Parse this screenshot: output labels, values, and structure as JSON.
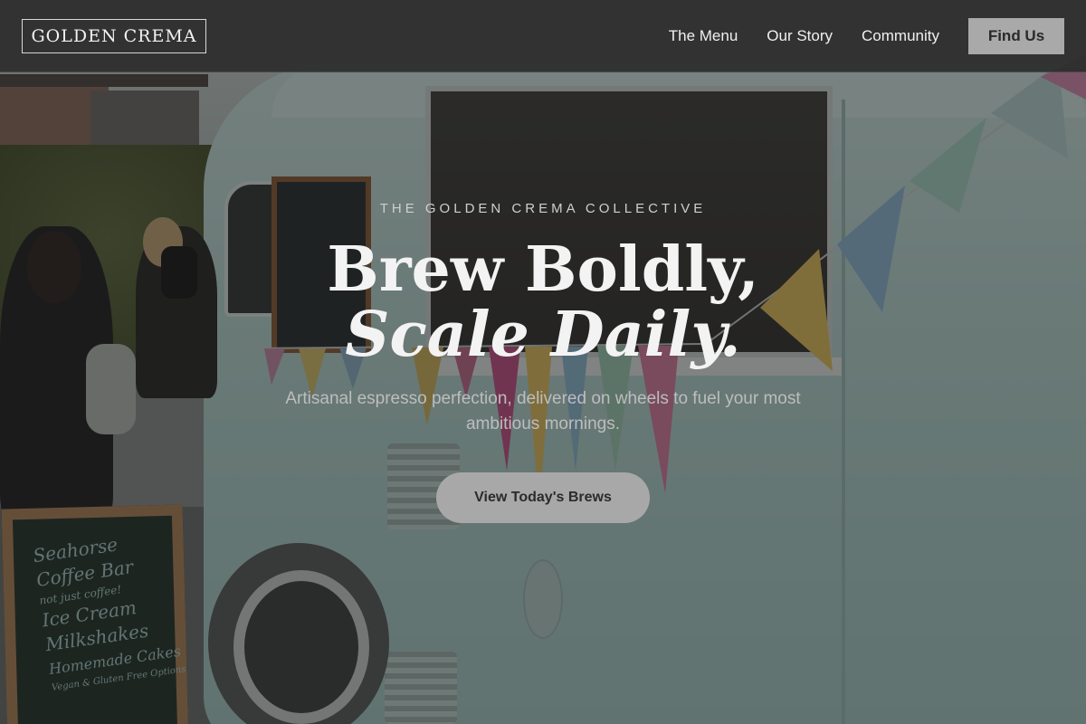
{
  "header": {
    "brand": "GOLDEN CREMA",
    "nav": [
      {
        "label": "The Menu"
      },
      {
        "label": "Our Story"
      },
      {
        "label": "Community"
      }
    ],
    "cta_label": "Find Us"
  },
  "hero": {
    "eyebrow": "THE GOLDEN CREMA COLLECTIVE",
    "headline_line1": "Brew Boldly,",
    "headline_line2": "Scale Daily.",
    "subtext": "Artisanal espresso perfection, delivered on wheels to fuel your most ambitious mornings.",
    "cta_label": "View Today's Brews",
    "background_scene": {
      "sign_lines": [
        "Seahorse",
        "Coffee Bar",
        "not just coffee!",
        "Ice Cream",
        "Milkshakes",
        "Homemade Cakes",
        "Vegan & Gluten Free Options"
      ]
    }
  },
  "colors": {
    "header_bg": "#2c2c2c",
    "button_gray": "#a9a9a9",
    "text_light": "#f3f3f3",
    "text_muted": "#bdbdbd",
    "van_mint": "#b7d9d3"
  }
}
